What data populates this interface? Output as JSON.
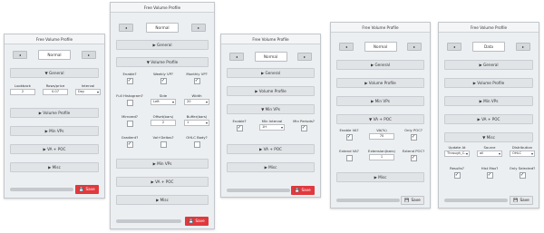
{
  "panels": [
    {
      "title": "Free Volume Profile",
      "nav": {
        "prev": "◂",
        "next": "▸",
        "label": "Normal"
      },
      "sections": [
        {
          "label": "▼ General"
        },
        {
          "label": "▶ Volume Profile"
        },
        {
          "label": "▶ Min VPs"
        },
        {
          "label": "▶ VA + POC"
        },
        {
          "label": "▶ Misc"
        }
      ],
      "fields": [
        {
          "label": "Lookback",
          "value": "2",
          "kind": "input"
        },
        {
          "label": "Rows/price",
          "value": "0.07",
          "kind": "input"
        },
        {
          "label": "Interval",
          "value": "Day",
          "kind": "select"
        }
      ],
      "save": {
        "label": "Save",
        "icon": "💾",
        "style": "red"
      }
    },
    {
      "title": "Free Volume Profile",
      "nav": {
        "prev": "◂",
        "next": "▸",
        "label": "Normal"
      },
      "sections": [
        {
          "label": "▶ General"
        },
        {
          "label": "▼ Volume Profile"
        },
        {
          "label": "▶ Min VPs"
        },
        {
          "label": "▶ VA + POC"
        },
        {
          "label": "▶ Misc"
        }
      ],
      "fields": [
        {
          "label": "Enable?",
          "checked": true,
          "kind": "check"
        },
        {
          "label": "Weekly VP?",
          "checked": true,
          "kind": "check"
        },
        {
          "label": "Monthly VP?",
          "checked": true,
          "kind": "check"
        },
        {
          "label": "Full Histogram?",
          "checked": false,
          "kind": "check"
        },
        {
          "label": "Side",
          "value": "Left",
          "kind": "select"
        },
        {
          "label": "Width",
          "value": "20",
          "kind": "select"
        },
        {
          "label": "Mirrored?",
          "checked": false,
          "kind": "check"
        },
        {
          "label": "Offset(bars)",
          "value": "2",
          "kind": "input"
        },
        {
          "label": "Buffer(bars)",
          "value": "1",
          "kind": "select"
        },
        {
          "label": "Gradient?",
          "checked": true,
          "kind": "check"
        },
        {
          "label": "Vol+Deltas?",
          "checked": false,
          "kind": "check"
        },
        {
          "label": "OHLC Body?",
          "checked": false,
          "kind": "check"
        }
      ],
      "save": {
        "label": "Save",
        "icon": "💾",
        "style": "red"
      }
    },
    {
      "title": "Free Volume Profile",
      "nav": {
        "prev": "◂",
        "next": "▸",
        "label": "Normal"
      },
      "sections": [
        {
          "label": "▶ General"
        },
        {
          "label": "▶ Volume Profile"
        },
        {
          "label": "▼ Min VPs"
        },
        {
          "label": "▶ VA + POC"
        },
        {
          "label": "▶ Misc"
        }
      ],
      "fields": [
        {
          "label": "Enable?",
          "checked": true,
          "kind": "check"
        },
        {
          "label": "Min Interval",
          "value": "1H",
          "kind": "select"
        },
        {
          "label": "Min Periods?",
          "checked": true,
          "kind": "check"
        }
      ],
      "save": {
        "label": "Save",
        "icon": "💾",
        "style": "red"
      }
    },
    {
      "title": "Free Volume Profile",
      "nav": {
        "prev": "◂",
        "next": "▸",
        "label": "Normal"
      },
      "sections": [
        {
          "label": "▶ General"
        },
        {
          "label": "▶ Volume Profile"
        },
        {
          "label": "▶ Min VPs"
        },
        {
          "label": "▼ VA + POC"
        },
        {
          "label": "▶ Misc"
        }
      ],
      "fields": [
        {
          "label": "Enable VA?",
          "checked": true,
          "kind": "check"
        },
        {
          "label": "VA(%)",
          "value": "70",
          "kind": "input"
        },
        {
          "label": "Only POC?",
          "checked": true,
          "kind": "check"
        },
        {
          "label": "Extend VA?",
          "checked": false,
          "kind": "check"
        },
        {
          "label": "Extension(bars)",
          "value": "1",
          "kind": "input"
        },
        {
          "label": "Extend POC?",
          "checked": true,
          "kind": "check"
        }
      ],
      "save": {
        "label": "Save",
        "icon": "💾",
        "style": "plain"
      }
    },
    {
      "title": "Free Volume Profile",
      "nav": {
        "prev": "◂",
        "next": "▸",
        "label": "Data"
      },
      "sections": [
        {
          "label": "▶ General"
        },
        {
          "label": "▶ Volume Profile"
        },
        {
          "label": "▶ Min VPs"
        },
        {
          "label": "▶ VA + POC"
        },
        {
          "label": "▼ Misc"
        }
      ],
      "fields": [
        {
          "label": "Update At",
          "value": "Through_C...",
          "kind": "select"
        },
        {
          "label": "Source",
          "value": "all",
          "kind": "select"
        },
        {
          "label": "Distribution",
          "value": "OHLC",
          "kind": "select"
        },
        {
          "label": "Results?",
          "checked": true,
          "kind": "check"
        },
        {
          "label": "Hist Max?",
          "checked": true,
          "kind": "check"
        },
        {
          "label": "Only Selected?",
          "checked": true,
          "kind": "check"
        }
      ],
      "save": {
        "label": "Save",
        "icon": "💾",
        "style": "plain"
      }
    }
  ]
}
